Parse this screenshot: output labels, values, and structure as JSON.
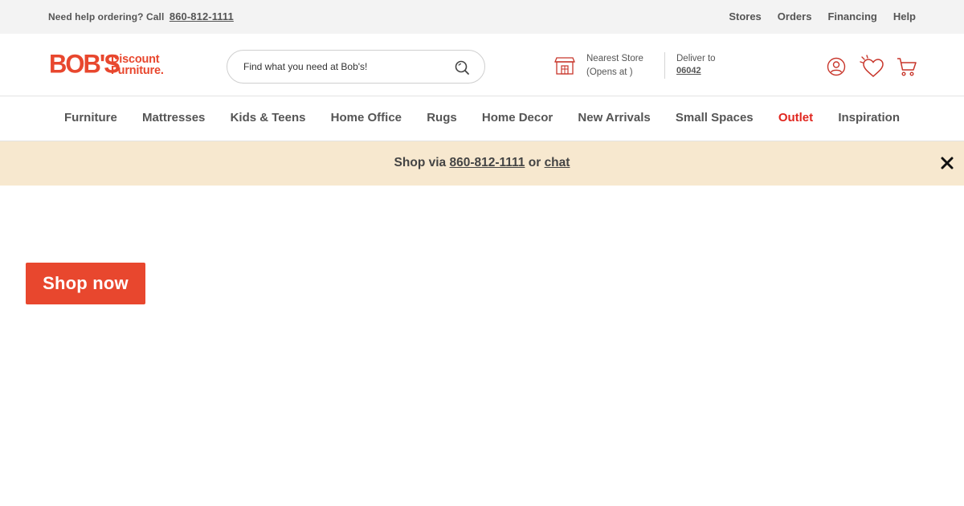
{
  "utility_bar": {
    "help_text": "Need help ordering? Call",
    "phone": "860-812-1111",
    "links": [
      "Stores",
      "Orders",
      "Financing",
      "Help"
    ]
  },
  "header": {
    "logo": {
      "brand": "BOB'S",
      "line1": "Discount",
      "line2": "Furniture."
    },
    "search": {
      "placeholder": "Find what you need at Bob's!",
      "icon": "search-icon"
    },
    "store": {
      "title": "Nearest Store",
      "subtitle": "(Opens at )",
      "icon": "store-icon"
    },
    "deliver": {
      "label": "Deliver to",
      "zip": "06042"
    },
    "icons": [
      "account-icon",
      "wishlist-icon",
      "cart-icon"
    ]
  },
  "nav": {
    "items": [
      "Furniture",
      "Mattresses",
      "Kids & Teens",
      "Home Office",
      "Rugs",
      "Home Decor",
      "New Arrivals",
      "Small Spaces",
      "Outlet",
      "Inspiration"
    ]
  },
  "banner": {
    "prefix": "Shop via",
    "phone": "860-812-1111",
    "connector": "or",
    "chat": "chat",
    "close_icon": "close-icon"
  },
  "hero": {
    "cta_label": "Shop now"
  },
  "colors": {
    "brand": "#e8472e",
    "outlet": "#e0261f",
    "banner_bg": "#f7e8cf",
    "utility_bg": "#f3f3f3"
  }
}
